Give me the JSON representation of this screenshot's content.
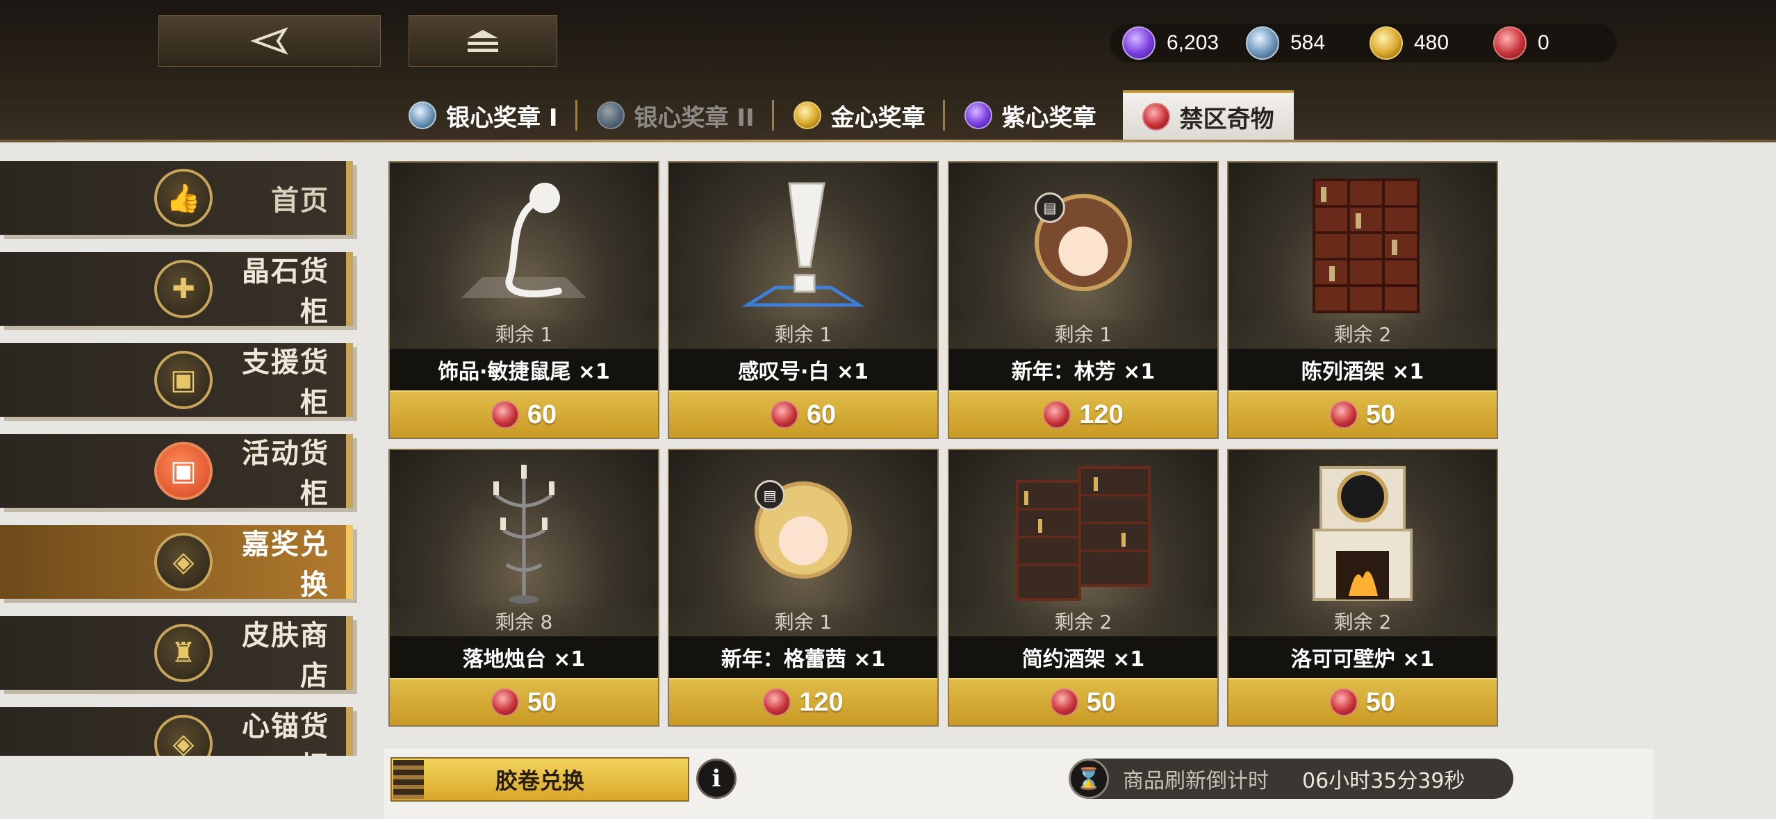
{
  "colors": {
    "accent_gold": "#d9a72a",
    "panel_dark": "#1c1a16"
  },
  "header": {
    "back_icon": "back-arrow-icon",
    "home_icon": "home-stack-icon",
    "currencies": [
      {
        "icon": "purple-heart-medal-icon",
        "value": "6,203"
      },
      {
        "icon": "silver-heart-medal-icon",
        "value": "584"
      },
      {
        "icon": "gold-heart-medal-icon",
        "value": "480"
      },
      {
        "icon": "forbidden-relic-token-icon",
        "value": "0"
      }
    ],
    "tabs": [
      {
        "label": "银心奖章 I"
      },
      {
        "label": "银心奖章 II"
      },
      {
        "label": "金心奖章"
      },
      {
        "label": "紫心奖章"
      },
      {
        "label": "禁区奇物"
      }
    ]
  },
  "sidebar": {
    "items": [
      {
        "label": "首页"
      },
      {
        "label": "晶石货柜"
      },
      {
        "label": "支援货柜"
      },
      {
        "label": "活动货柜"
      },
      {
        "label": "嘉奖兑换"
      },
      {
        "label": "皮肤商店"
      },
      {
        "label": "心锚货柜"
      }
    ]
  },
  "products": [
    {
      "remain": "剩余 1",
      "name": "饰品·敏捷鼠尾 ×1",
      "price": "60"
    },
    {
      "remain": "剩余 1",
      "name": "感叹号·白 ×1",
      "price": "60"
    },
    {
      "remain": "剩余 1",
      "name": "新年：林芳 ×1",
      "price": "120"
    },
    {
      "remain": "剩余 2",
      "name": "陈列酒架 ×1",
      "price": "50"
    },
    {
      "remain": "剩余 8",
      "name": "落地烛台 ×1",
      "price": "50"
    },
    {
      "remain": "剩余 1",
      "name": "新年：格蕾茜 ×1",
      "price": "120"
    },
    {
      "remain": "剩余 2",
      "name": "简约酒架 ×1",
      "price": "50"
    },
    {
      "remain": "剩余 2",
      "name": "洛可可壁炉 ×1",
      "price": "50"
    }
  ],
  "footer": {
    "film_exchange_label": "胶卷兑换",
    "info_label": "i",
    "refresh_label": "商品刷新倒计时",
    "refresh_value": "06小时35分39秒"
  }
}
